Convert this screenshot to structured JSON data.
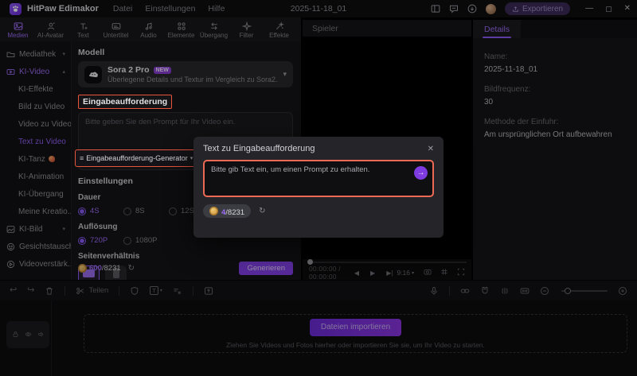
{
  "titlebar": {
    "app_name": "HitPaw Edimakor",
    "menus": [
      "Datei",
      "Einstellungen",
      "Hilfe"
    ],
    "project_title": "2025-11-18_01",
    "export_label": "Exportieren",
    "window_controls": [
      "minimize",
      "maximize",
      "close"
    ]
  },
  "ribbon": {
    "tabs": [
      {
        "label": "Medien",
        "icon": "media-icon",
        "active": true
      },
      {
        "label": "AI-Avatar",
        "icon": "avatar-icon",
        "active": false
      },
      {
        "label": "Text",
        "icon": "text-icon",
        "active": false
      },
      {
        "label": "Untertitel",
        "icon": "subtitle-icon",
        "active": false
      },
      {
        "label": "Audio",
        "icon": "audio-icon",
        "active": false
      },
      {
        "label": "Elemente",
        "icon": "elements-icon",
        "active": false
      },
      {
        "label": "Übergang",
        "icon": "transition-icon",
        "active": false
      },
      {
        "label": "Filter",
        "icon": "filter-icon",
        "active": false
      },
      {
        "label": "Effekte",
        "icon": "effects-icon",
        "active": false
      }
    ]
  },
  "sidebar": {
    "items": [
      {
        "label": "Mediathek",
        "icon": "folder-icon",
        "caret": "▾",
        "level": 0
      },
      {
        "label": "KI-Video",
        "icon": "ai-video-icon",
        "caret": "▴",
        "level": 0,
        "active": true
      },
      {
        "label": "KI-Effekte",
        "level": 1
      },
      {
        "label": "Bild zu Video",
        "level": 1
      },
      {
        "label": "Video zu Video",
        "level": 1
      },
      {
        "label": "Text zu Video",
        "level": 1,
        "selected": true
      },
      {
        "label": "KI-Tanz",
        "level": 1,
        "emoji": "dancer-emoji"
      },
      {
        "label": "KI-Animation",
        "level": 1
      },
      {
        "label": "KI-Übergang",
        "level": 1
      },
      {
        "label": "Meine Kreatio...",
        "level": 1
      },
      {
        "label": "KI-Bild",
        "icon": "ai-image-icon",
        "caret": "▾",
        "level": 0
      },
      {
        "label": "Gesichtstausch",
        "icon": "face-swap-icon",
        "caret": "▾",
        "level": 0
      },
      {
        "label": "Videoverstärk...",
        "icon": "video-enhance-icon",
        "caret": "▾",
        "level": 0
      }
    ]
  },
  "generator_panel": {
    "model_heading": "Modell",
    "model": {
      "name": "Sora 2 Pro",
      "badge": "NEW",
      "description": "Überlegene Details und Textur im Vergleich zu Sora2."
    },
    "prompt_heading": "Eingabeaufforderung",
    "prompt_placeholder": "Bitte geben Sie den Prompt für Ihr Video ein.",
    "generator_button_label": "Eingabeaufforderung-Generator",
    "settings_heading": "Einstellungen",
    "duration": {
      "label": "Dauer",
      "options": [
        "4S",
        "8S",
        "12S"
      ],
      "selected": "4S"
    },
    "resolution": {
      "label": "Auflösung",
      "options": [
        "720P",
        "1080P"
      ],
      "selected": "720P"
    },
    "aspect": {
      "label": "Seitenverhältnis",
      "options": [
        "16:9",
        "9:16"
      ],
      "selected": "16:9"
    },
    "credits_used": "600",
    "credits_total": "/8231",
    "generate_label": "Generieren"
  },
  "player": {
    "title": "Spieler",
    "timecode": "00:00:00 / 00:00:00",
    "aspect_ratio": "9:16"
  },
  "details": {
    "tab_label": "Details",
    "fields": [
      {
        "label": "Name:",
        "value": "2025-11-18_01"
      },
      {
        "label": "Bildfrequenz:",
        "value": "30"
      },
      {
        "label": "Methode der Einfuhr:",
        "value": "Am ursprünglichen Ort aufbewahren"
      }
    ]
  },
  "modal": {
    "title": "Text zu Eingabeaufforderung",
    "input_placeholder": "Bitte gib Text ein, um einen Prompt zu erhalten.",
    "credits_used": "4",
    "credits_total": "/8231"
  },
  "timeline_toolbar": {
    "split_label": "Teilen"
  },
  "timeline": {
    "import_button": "Dateien importieren",
    "hint": "Ziehen Sie Videos und Fotos hierher oder importieren Sie sie, um Ihr Video zu starten."
  },
  "colors": {
    "accent": "#8b5cf6",
    "annotation_border": "#e8543c",
    "modal_input_border": "#ec6a55",
    "coin": "#d9a33c",
    "generate_button": "#8440ea"
  }
}
